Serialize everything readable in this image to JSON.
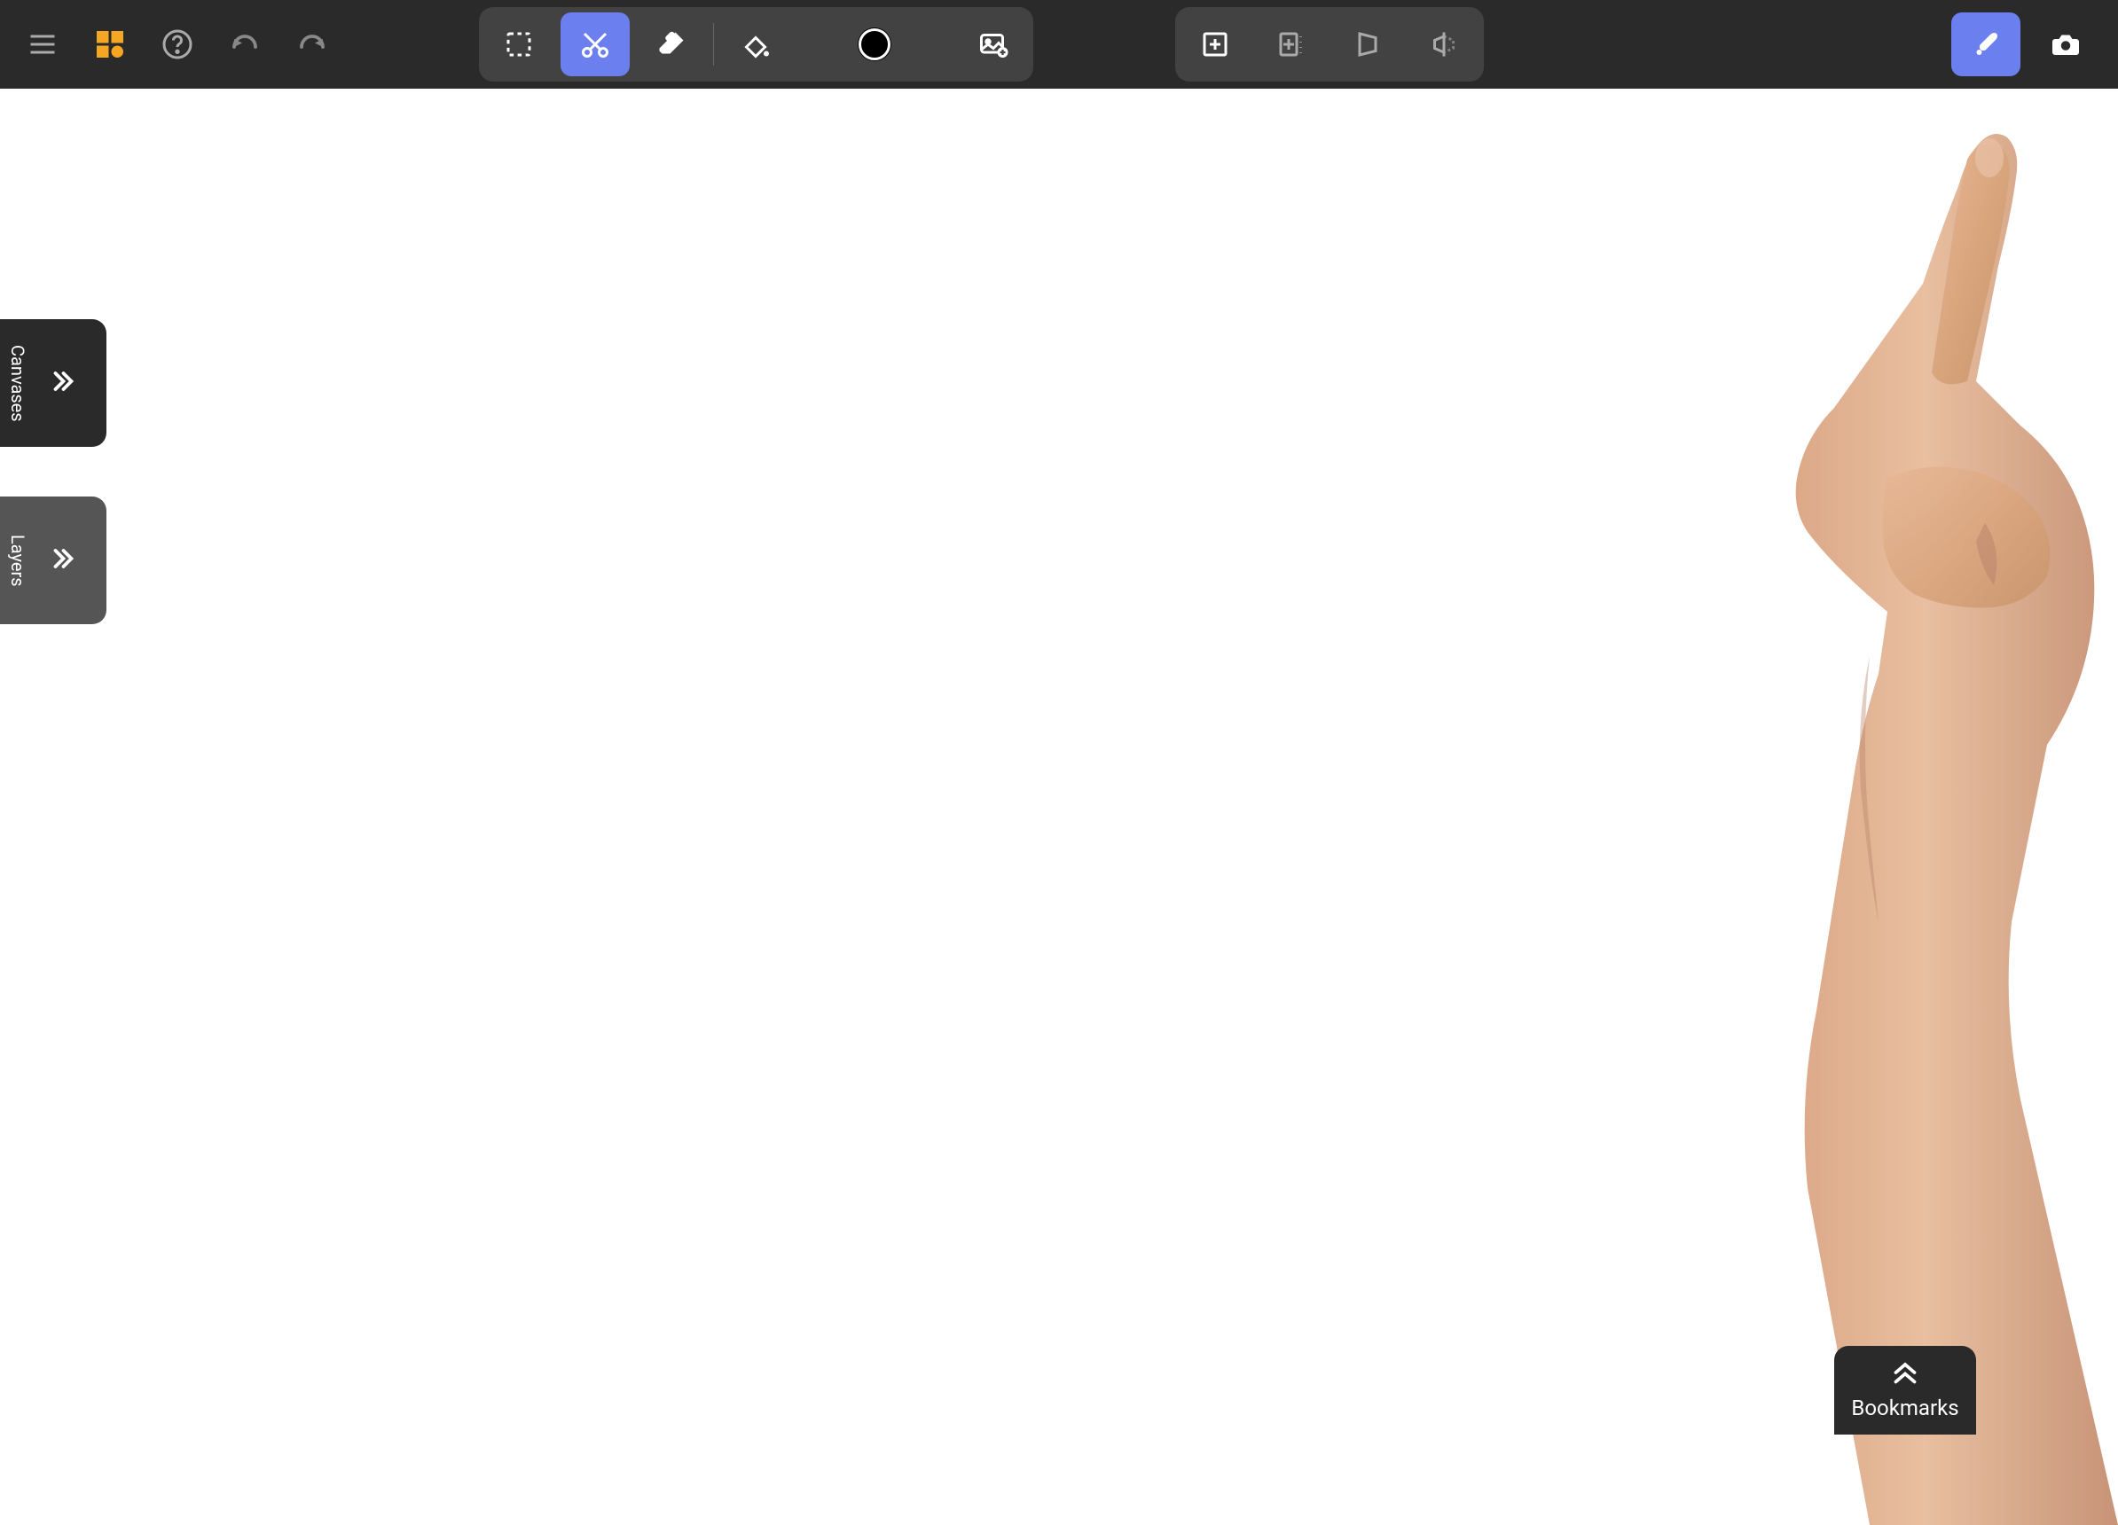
{
  "toolbar": {
    "menu": "menu",
    "app": "app",
    "help": "help",
    "undo": "undo",
    "redo": "redo",
    "select": "select",
    "scissors": "scissors",
    "eraser": "eraser",
    "fill": "fill",
    "color": "#000000",
    "image": "image",
    "add_frame": "add-frame",
    "guides": "guides",
    "perspective": "perspective",
    "mirror": "mirror",
    "brush": "brush",
    "camera": "camera"
  },
  "panels": {
    "canvases": "Canvases",
    "layers": "Layers",
    "bookmarks": "Bookmarks"
  }
}
